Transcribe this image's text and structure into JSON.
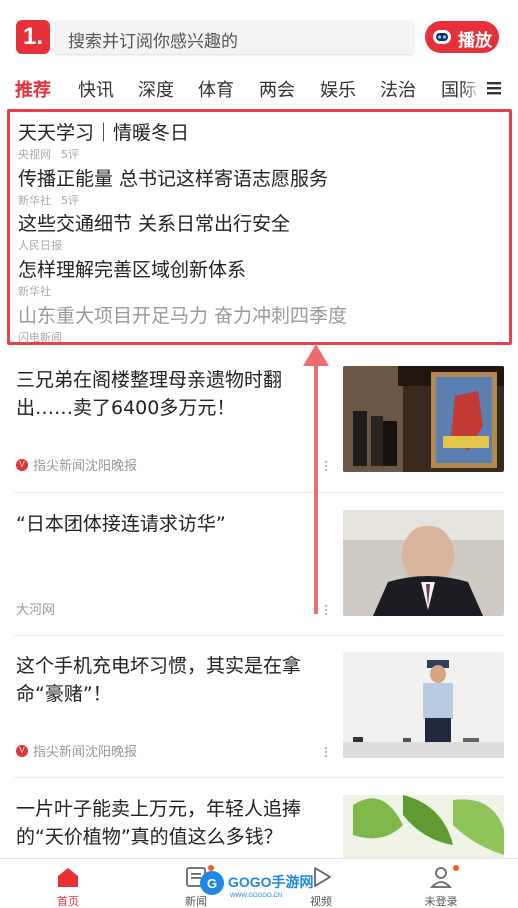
{
  "header": {
    "logo_text": "1.",
    "search_placeholder": "搜索并订阅你感兴趣的",
    "play_label": "播放"
  },
  "tabs": [
    {
      "label": "推荐",
      "active": true
    },
    {
      "label": "快讯"
    },
    {
      "label": "深度"
    },
    {
      "label": "体育"
    },
    {
      "label": "两会"
    },
    {
      "label": "娱乐"
    },
    {
      "label": "法治"
    },
    {
      "label": "国际"
    }
  ],
  "headlines": [
    {
      "title": "天天学习｜情暖冬日",
      "source": "央视网",
      "comments": "5评"
    },
    {
      "title": "传播正能量 总书记这样寄语志愿服务",
      "source": "新华社",
      "comments": "5评"
    },
    {
      "title": "这些交通细节 关系日常出行安全",
      "source": "人民日报",
      "comments": ""
    },
    {
      "title": "怎样理解完善区域创新体系",
      "source": "新华社",
      "comments": ""
    },
    {
      "title": "山东重大项目开足马力 奋力冲刺四季度",
      "source": "闪电新闻",
      "comments": ""
    }
  ],
  "news": [
    {
      "title": "三兄弟在阁楼整理母亲遗物时翻出……卖了6400多万元！",
      "source": "指尖新闻沈阳晚报",
      "badge": "V",
      "image": "superman-painting-photo"
    },
    {
      "title": "“日本团体接连请求访华”",
      "source": "大河网",
      "badge": "",
      "image": "older-man-portrait-photo"
    },
    {
      "title": "这个手机充电坏习惯，其实是在拿命“豪赌”！",
      "source": "指尖新闻沈阳晚报",
      "badge": "V",
      "image": "fire-officer-demo-photo"
    },
    {
      "title": "一片叶子能卖上万元，年轻人追捧的“天价植物”真的值这么多钱？",
      "source": "",
      "badge": "",
      "image": "plant-leaves-photo"
    }
  ],
  "bottom_nav": [
    {
      "label": "首页",
      "icon": "home-icon",
      "active": true
    },
    {
      "label": "新闻",
      "icon": "news-icon"
    },
    {
      "label": "视频",
      "icon": "video-icon"
    },
    {
      "label": "未登录",
      "icon": "user-icon"
    }
  ],
  "watermark": {
    "text": "GOGO手游网",
    "sub": "WWW.GOGGO.CN"
  },
  "colors": {
    "accent": "#e8303a",
    "highlight_box": "#e8404b"
  }
}
